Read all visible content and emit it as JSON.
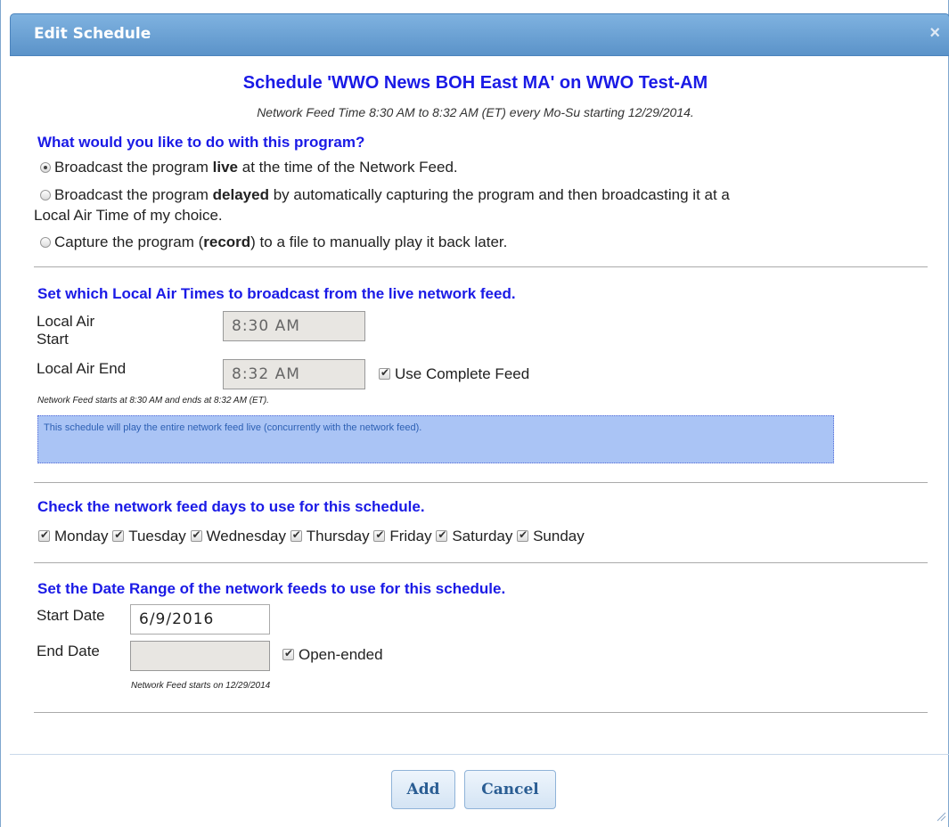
{
  "dialog": {
    "title": "Edit Schedule",
    "close_symbol": "×",
    "heading": "Schedule 'WWO News BOH East MA' on WWO Test-AM",
    "subtitle": "Network Feed Time 8:30 AM to 8:32 AM (ET) every Mo-Su starting 12/29/2014."
  },
  "program_action": {
    "question": "What would you like to do with this program?",
    "options": [
      {
        "pre": "Broadcast the program ",
        "bold": "live",
        "post": " at the time of the Network Feed.",
        "selected": true
      },
      {
        "pre": "Broadcast the program ",
        "bold": "delayed",
        "post": " by automatically capturing the program and then broadcasting it at a",
        "cont": "Local Air Time of my choice.",
        "selected": false
      },
      {
        "pre": "Capture the program (",
        "bold": "record",
        "post": ") to a file to manually play it back later.",
        "selected": false
      }
    ]
  },
  "air_times": {
    "title": "Set which Local Air Times to broadcast from the live network feed.",
    "start_label_1": "Local Air",
    "start_label_2": "Start",
    "start_value": "8:30 AM",
    "end_label": "Local Air End",
    "end_value": "8:32 AM",
    "use_complete_feed_label": "Use Complete Feed",
    "use_complete_feed_checked": true,
    "note": "Network Feed starts at 8:30 AM and ends at 8:32 AM (ET).",
    "info": "This schedule will play the entire network feed live (concurrently with the network feed)."
  },
  "days": {
    "title": "Check the network feed days to use for this schedule.",
    "items": [
      {
        "label": "Monday",
        "checked": true
      },
      {
        "label": "Tuesday",
        "checked": true
      },
      {
        "label": "Wednesday",
        "checked": true
      },
      {
        "label": "Thursday",
        "checked": true
      },
      {
        "label": "Friday",
        "checked": true
      },
      {
        "label": "Saturday",
        "checked": true
      },
      {
        "label": "Sunday",
        "checked": true
      }
    ]
  },
  "date_range": {
    "title": "Set the Date Range of the network feeds to use for this schedule.",
    "start_label": "Start Date",
    "start_value": "6/9/2016",
    "end_label": "End Date",
    "end_value": "",
    "open_ended_label": "Open-ended",
    "open_ended_checked": true,
    "note": "Network Feed starts on 12/29/2014"
  },
  "buttons": {
    "add": "Add",
    "cancel": "Cancel"
  },
  "colors": {
    "heading": "#1a1ae6",
    "titlebar": "#6aa2d6",
    "info_box": "#aac4f5"
  }
}
